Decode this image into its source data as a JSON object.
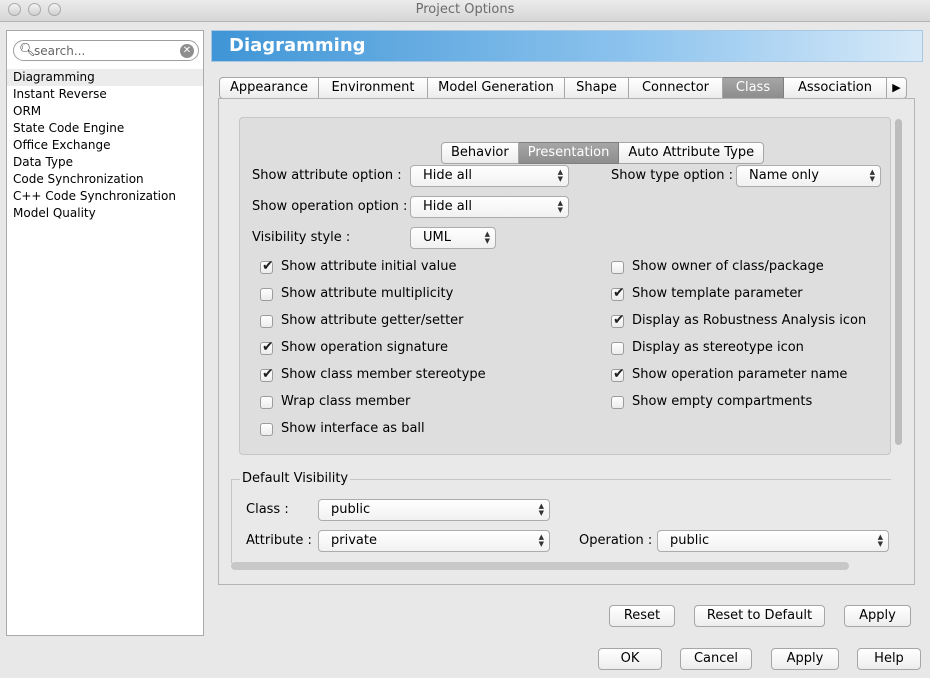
{
  "window": {
    "title": "Project Options"
  },
  "search": {
    "placeholder": "search..."
  },
  "sidebar": {
    "items": [
      {
        "label": "Diagramming"
      },
      {
        "label": "Instant Reverse"
      },
      {
        "label": "ORM"
      },
      {
        "label": "State Code Engine"
      },
      {
        "label": "Office Exchange"
      },
      {
        "label": "Data Type"
      },
      {
        "label": "Code Synchronization"
      },
      {
        "label": "C++ Code Synchronization"
      },
      {
        "label": "Model Quality"
      }
    ],
    "selected": "Diagramming"
  },
  "header": {
    "title": "Diagramming"
  },
  "tabs": {
    "items": [
      {
        "label": "Appearance"
      },
      {
        "label": "Environment"
      },
      {
        "label": "Model Generation"
      },
      {
        "label": "Shape"
      },
      {
        "label": "Connector"
      },
      {
        "label": "Class"
      },
      {
        "label": "Association"
      },
      {
        "label": "▶"
      }
    ],
    "active": "Class"
  },
  "subtabs": {
    "items": [
      {
        "label": "Behavior"
      },
      {
        "label": "Presentation"
      },
      {
        "label": "Auto Attribute Type"
      }
    ],
    "active": "Presentation"
  },
  "presentation": {
    "attribute_option": {
      "label": "Show attribute option :",
      "value": "Hide all"
    },
    "operation_option": {
      "label": "Show operation option :",
      "value": "Hide all"
    },
    "type_option": {
      "label": "Show type option :",
      "value": "Name only"
    },
    "visibility_style": {
      "label": "Visibility style :",
      "value": "UML"
    },
    "checkboxes": [
      {
        "label": "Show attribute initial value",
        "checked": true
      },
      {
        "label": "Show attribute multiplicity",
        "checked": false
      },
      {
        "label": "Show attribute getter/setter",
        "checked": false
      },
      {
        "label": "Show operation signature",
        "checked": true
      },
      {
        "label": "Show class member stereotype",
        "checked": true
      },
      {
        "label": "Wrap class member",
        "checked": false
      },
      {
        "label": "Show interface as ball",
        "checked": false
      },
      {
        "label": "Show owner of class/package",
        "checked": false
      },
      {
        "label": "Show template parameter",
        "checked": true
      },
      {
        "label": "Display as Robustness Analysis icon",
        "checked": true
      },
      {
        "label": "Display as stereotype icon",
        "checked": false
      },
      {
        "label": "Show operation parameter name",
        "checked": true
      },
      {
        "label": "Show empty compartments",
        "checked": false
      }
    ]
  },
  "default_visibility": {
    "title": "Default Visibility",
    "class": {
      "label": "Class :",
      "value": "public"
    },
    "attribute": {
      "label": "Attribute :",
      "value": "private"
    },
    "operation": {
      "label": "Operation :",
      "value": "public"
    }
  },
  "panel_buttons": {
    "reset": "Reset",
    "reset_default": "Reset to Default",
    "apply": "Apply"
  },
  "dialog_buttons": {
    "ok": "OK",
    "cancel": "Cancel",
    "apply": "Apply",
    "help": "Help"
  },
  "check_mark": "✔",
  "arrows_glyph": "▲▼"
}
